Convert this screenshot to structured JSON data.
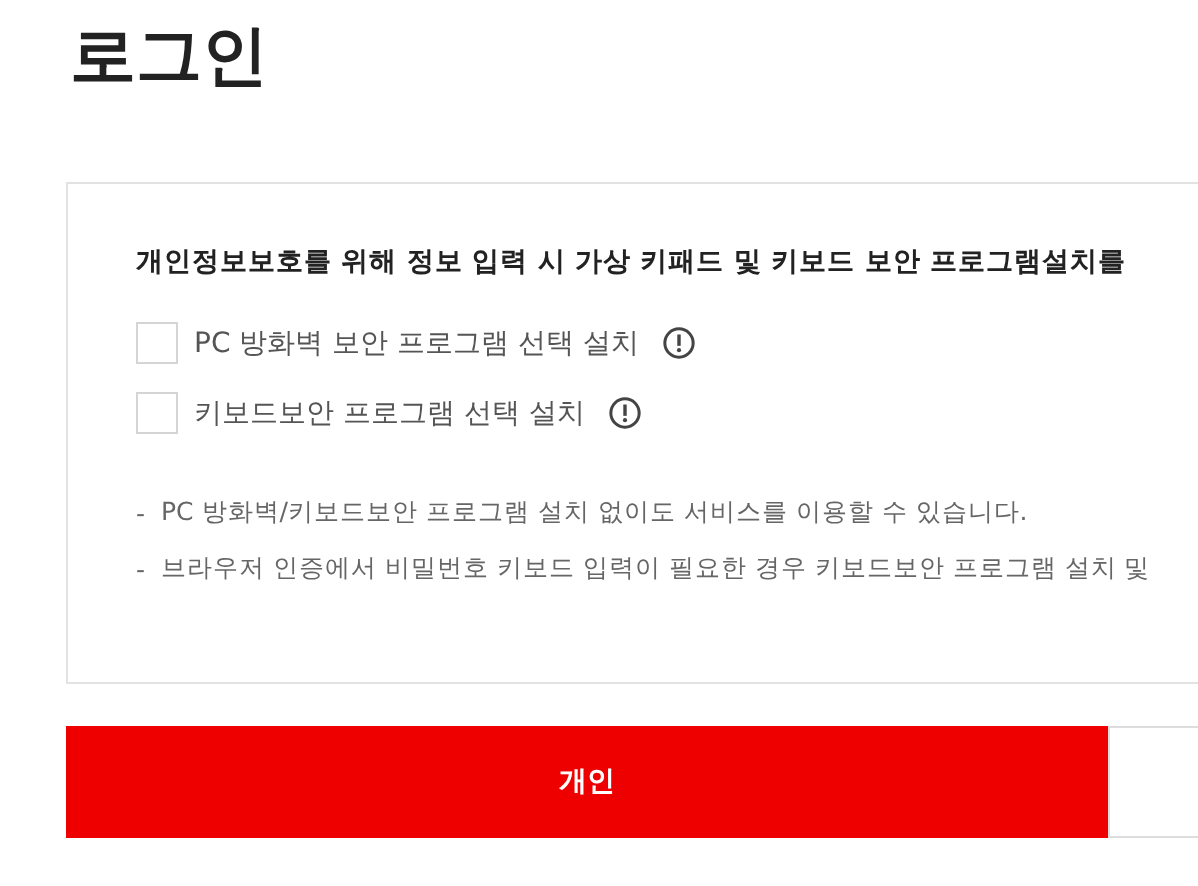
{
  "title": "로그인",
  "notice": {
    "heading": "개인정보보호를 위해 정보 입력 시 가상 키패드 및 키보드 보안 프로그램설치를",
    "options": [
      {
        "label": "PC 방화벽 보안 프로그램 선택 설치",
        "checked": false
      },
      {
        "label": "키보드보안 프로그램 선택 설치",
        "checked": false
      }
    ],
    "notes": [
      {
        "bullet": "-",
        "text": "PC 방화벽/키보드보안 프로그램 설치 없이도 서비스를 이용할 수 있습니다."
      },
      {
        "bullet": "-",
        "text": "브라우저 인증에서 비밀번호 키보드 입력이 필요한 경우 키보드보안 프로그램 설치 및"
      }
    ]
  },
  "tabs": [
    {
      "label": "개인",
      "selected": true
    },
    {
      "selected": false
    }
  ]
}
